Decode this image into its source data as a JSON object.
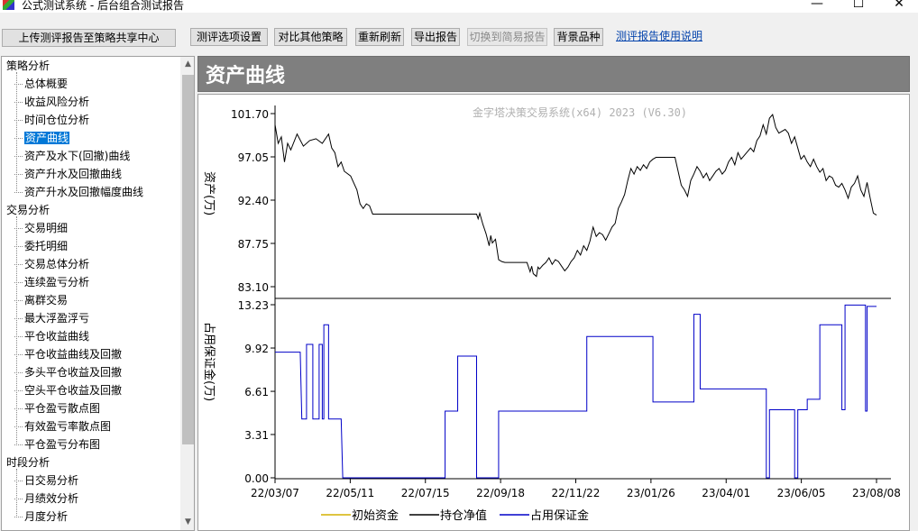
{
  "window": {
    "title": "公式测试系统 - 后台组合测试报告",
    "minimize": "—",
    "maximize": "☐",
    "close": "✕"
  },
  "toolbar": {
    "upload": "上传测评报告至策略共享中心",
    "options": "测评选项设置",
    "compare": "对比其他策略",
    "refresh": "重新刷新",
    "export": "导出报告",
    "switch_simple": "切换到简易报告",
    "background": "背景品种",
    "help": "测评报告使用说明"
  },
  "sidebar": {
    "groups": [
      {
        "label": "策略分析",
        "items": [
          "总体概要",
          "收益风险分析",
          "时间仓位分析",
          "资产曲线",
          "资产及水下(回撤)曲线",
          "资产升水及回撤曲线",
          "资产升水及回撤幅度曲线"
        ]
      },
      {
        "label": "交易分析",
        "items": [
          "交易明细",
          "委托明细",
          "交易总体分析",
          "连续盈亏分析",
          "离群交易",
          "最大浮盈浮亏",
          "平仓收益曲线",
          "平仓收益曲线及回撤",
          "多头平仓收益及回撤",
          "空头平仓收益及回撤",
          "平仓盈亏散点图",
          "有效盈亏率散点图",
          "平仓盈亏分布图"
        ]
      },
      {
        "label": "时段分析",
        "items": [
          "日交易分析",
          "月绩效分析",
          "月度分析"
        ]
      }
    ],
    "selected": "资产曲线"
  },
  "section": {
    "title": "资产曲线"
  },
  "chart_data": {
    "type": "line",
    "title": "金字塔决策交易系统(x64) 2023 (V6.30)",
    "x_ticks": [
      "22/03/07",
      "22/05/11",
      "22/07/15",
      "22/09/18",
      "22/11/22",
      "23/01/26",
      "23/04/01",
      "23/06/05",
      "23/08/08"
    ],
    "legend": [
      "初始资金",
      "持仓净值",
      "占用保证金"
    ],
    "colors": {
      "initial": "#d4b000",
      "net": "#000000",
      "margin": "#0000c8"
    },
    "top": {
      "ylabel": "资产(万)",
      "ylim": [
        83.1,
        101.7
      ],
      "yticks": [
        "101.70",
        "97.05",
        "92.40",
        "87.75",
        "83.10"
      ],
      "series_name": "持仓净值",
      "points": [
        [
          0,
          100.5
        ],
        [
          0.1,
          98.5
        ],
        [
          0.2,
          99.2
        ],
        [
          0.3,
          96.5
        ],
        [
          0.4,
          98.5
        ],
        [
          0.5,
          97.8
        ],
        [
          0.7,
          99.5
        ],
        [
          0.9,
          98.2
        ],
        [
          1.1,
          98.8
        ],
        [
          1.3,
          99.0
        ],
        [
          1.5,
          98.5
        ],
        [
          1.7,
          99.5
        ],
        [
          1.8,
          98.0
        ],
        [
          1.9,
          97.5
        ],
        [
          2.0,
          96.0
        ],
        [
          2.1,
          96.5
        ],
        [
          2.2,
          95.5
        ],
        [
          2.4,
          95.0
        ],
        [
          2.6,
          93.5
        ],
        [
          2.7,
          92.0
        ],
        [
          2.8,
          91.5
        ],
        [
          2.9,
          92.0
        ],
        [
          3.0,
          91.8
        ],
        [
          3.1,
          90.9
        ],
        [
          3.2,
          90.9
        ],
        [
          3.4,
          90.9
        ],
        [
          4.0,
          90.9
        ],
        [
          5.0,
          90.9
        ],
        [
          5.5,
          90.9
        ],
        [
          6.0,
          90.9
        ],
        [
          6.4,
          90.9
        ],
        [
          6.45,
          90.4
        ],
        [
          6.5,
          91.0
        ],
        [
          6.6,
          89.8
        ],
        [
          6.7,
          88.8
        ],
        [
          6.8,
          87.5
        ],
        [
          6.85,
          88.6
        ],
        [
          6.9,
          87.8
        ],
        [
          7.0,
          88.2
        ],
        [
          7.1,
          86.0
        ],
        [
          7.2,
          85.8
        ],
        [
          7.3,
          85.7
        ],
        [
          7.6,
          85.7
        ],
        [
          7.8,
          85.7
        ],
        [
          8.0,
          85.7
        ],
        [
          8.1,
          84.7
        ],
        [
          8.15,
          85.3
        ],
        [
          8.2,
          84.5
        ],
        [
          8.3,
          84.2
        ],
        [
          8.35,
          85.2
        ],
        [
          8.4,
          85.0
        ],
        [
          8.5,
          85.4
        ],
        [
          8.6,
          85.7
        ],
        [
          8.7,
          86.2
        ],
        [
          8.8,
          85.5
        ],
        [
          8.9,
          86.0
        ],
        [
          9.0,
          85.8
        ],
        [
          9.1,
          85.3
        ],
        [
          9.2,
          84.8
        ],
        [
          9.3,
          85.2
        ],
        [
          9.4,
          85.8
        ],
        [
          9.5,
          86.2
        ],
        [
          9.6,
          87.0
        ],
        [
          9.7,
          86.5
        ],
        [
          9.8,
          87.5
        ],
        [
          9.9,
          87.0
        ],
        [
          10.0,
          88.0
        ],
        [
          10.1,
          89.5
        ],
        [
          10.2,
          88.5
        ],
        [
          10.3,
          88.9
        ],
        [
          10.4,
          88.7
        ],
        [
          10.5,
          88.1
        ],
        [
          10.6,
          88.8
        ],
        [
          10.7,
          89.5
        ],
        [
          10.8,
          89.9
        ],
        [
          10.9,
          91.5
        ],
        [
          11.0,
          92.2
        ],
        [
          11.1,
          93.0
        ],
        [
          11.2,
          94.5
        ],
        [
          11.3,
          95.8
        ],
        [
          11.4,
          95.2
        ],
        [
          11.5,
          96.0
        ],
        [
          11.6,
          95.6
        ],
        [
          11.7,
          96.2
        ],
        [
          11.8,
          95.8
        ],
        [
          11.9,
          96.5
        ],
        [
          12.0,
          96.8
        ],
        [
          12.1,
          97.0
        ],
        [
          12.3,
          97.0
        ],
        [
          12.5,
          97.0
        ],
        [
          12.7,
          97.0
        ],
        [
          12.8,
          95.5
        ],
        [
          12.9,
          94.0
        ],
        [
          13.0,
          93.5
        ],
        [
          13.1,
          92.8
        ],
        [
          13.2,
          94.5
        ],
        [
          13.3,
          95.2
        ],
        [
          13.4,
          96.0
        ],
        [
          13.5,
          95.5
        ],
        [
          13.6,
          94.8
        ],
        [
          13.7,
          95.3
        ],
        [
          13.8,
          94.5
        ],
        [
          13.9,
          95.0
        ],
        [
          14.0,
          95.5
        ],
        [
          14.1,
          95.8
        ],
        [
          14.2,
          95.2
        ],
        [
          14.3,
          95.6
        ],
        [
          14.4,
          96.5
        ],
        [
          14.5,
          97.0
        ],
        [
          14.6,
          96.2
        ],
        [
          14.7,
          97.5
        ],
        [
          14.8,
          96.8
        ],
        [
          14.9,
          97.2
        ],
        [
          15.0,
          97.6
        ],
        [
          15.1,
          98.0
        ],
        [
          15.2,
          97.6
        ],
        [
          15.3,
          98.8
        ],
        [
          15.4,
          99.3
        ],
        [
          15.5,
          100.5
        ],
        [
          15.6,
          99.5
        ],
        [
          15.7,
          101.2
        ],
        [
          15.8,
          101.6
        ],
        [
          15.9,
          100.2
        ],
        [
          16.0,
          99.6
        ],
        [
          16.1,
          99.8
        ],
        [
          16.2,
          100.0
        ],
        [
          16.3,
          99.6
        ],
        [
          16.4,
          98.5
        ],
        [
          16.5,
          99.2
        ],
        [
          16.6,
          98.0
        ],
        [
          16.7,
          96.8
        ],
        [
          16.8,
          97.2
        ],
        [
          16.9,
          96.5
        ],
        [
          17.0,
          96.0
        ],
        [
          17.1,
          96.8
        ],
        [
          17.2,
          96.0
        ],
        [
          17.3,
          95.4
        ],
        [
          17.4,
          95.8
        ],
        [
          17.5,
          94.5
        ],
        [
          17.6,
          95.0
        ],
        [
          17.7,
          94.8
        ],
        [
          17.8,
          94.0
        ],
        [
          17.9,
          93.8
        ],
        [
          18.0,
          94.2
        ],
        [
          18.1,
          93.5
        ],
        [
          18.2,
          92.6
        ],
        [
          18.3,
          93.8
        ],
        [
          18.4,
          94.2
        ],
        [
          18.5,
          95.0
        ],
        [
          18.6,
          93.5
        ],
        [
          18.7,
          92.8
        ],
        [
          18.8,
          94.3
        ],
        [
          18.9,
          92.6
        ],
        [
          19.0,
          91.0
        ],
        [
          19.1,
          90.8
        ]
      ]
    },
    "bottom": {
      "ylabel": "占用保证金(万)",
      "ylim": [
        0,
        13.23
      ],
      "yticks": [
        "13.23",
        "9.92",
        "6.61",
        "3.31",
        "0.00"
      ],
      "series_name": "占用保证金",
      "points": [
        [
          0,
          9.6
        ],
        [
          0.8,
          9.6
        ],
        [
          0.85,
          4.5
        ],
        [
          1.0,
          4.5
        ],
        [
          1.0,
          10.2
        ],
        [
          1.2,
          10.2
        ],
        [
          1.2,
          4.5
        ],
        [
          1.4,
          4.5
        ],
        [
          1.4,
          10.2
        ],
        [
          1.5,
          10.2
        ],
        [
          1.5,
          4.5
        ],
        [
          1.55,
          4.5
        ],
        [
          1.55,
          11.7
        ],
        [
          1.7,
          11.7
        ],
        [
          1.7,
          4.5
        ],
        [
          2.1,
          4.5
        ],
        [
          2.15,
          0
        ],
        [
          4.5,
          0
        ],
        [
          5.4,
          0
        ],
        [
          5.4,
          5.1
        ],
        [
          5.8,
          5.1
        ],
        [
          5.8,
          9.3
        ],
        [
          6.4,
          9.3
        ],
        [
          6.4,
          0
        ],
        [
          7.1,
          0
        ],
        [
          7.1,
          5.1
        ],
        [
          8.5,
          5.1
        ],
        [
          9.9,
          5.1
        ],
        [
          9.9,
          10.8
        ],
        [
          11.5,
          10.8
        ],
        [
          12.0,
          10.8
        ],
        [
          12.0,
          5.8
        ],
        [
          13.3,
          5.8
        ],
        [
          13.3,
          12.5
        ],
        [
          13.5,
          12.5
        ],
        [
          13.5,
          6.8
        ],
        [
          15.0,
          6.8
        ],
        [
          15.6,
          6.8
        ],
        [
          15.6,
          0
        ],
        [
          15.7,
          0
        ],
        [
          15.7,
          5.2
        ],
        [
          16.5,
          5.2
        ],
        [
          16.5,
          0
        ],
        [
          16.6,
          0
        ],
        [
          16.6,
          5.2
        ],
        [
          16.9,
          5.2
        ],
        [
          16.9,
          6.0
        ],
        [
          17.3,
          6.0
        ],
        [
          17.3,
          11.7
        ],
        [
          18.0,
          11.7
        ],
        [
          18.0,
          5.2
        ],
        [
          18.1,
          5.2
        ],
        [
          18.1,
          13.2
        ],
        [
          18.75,
          13.2
        ],
        [
          18.75,
          5.1
        ],
        [
          18.8,
          5.1
        ],
        [
          18.8,
          13.1
        ],
        [
          19.1,
          13.1
        ]
      ]
    }
  }
}
